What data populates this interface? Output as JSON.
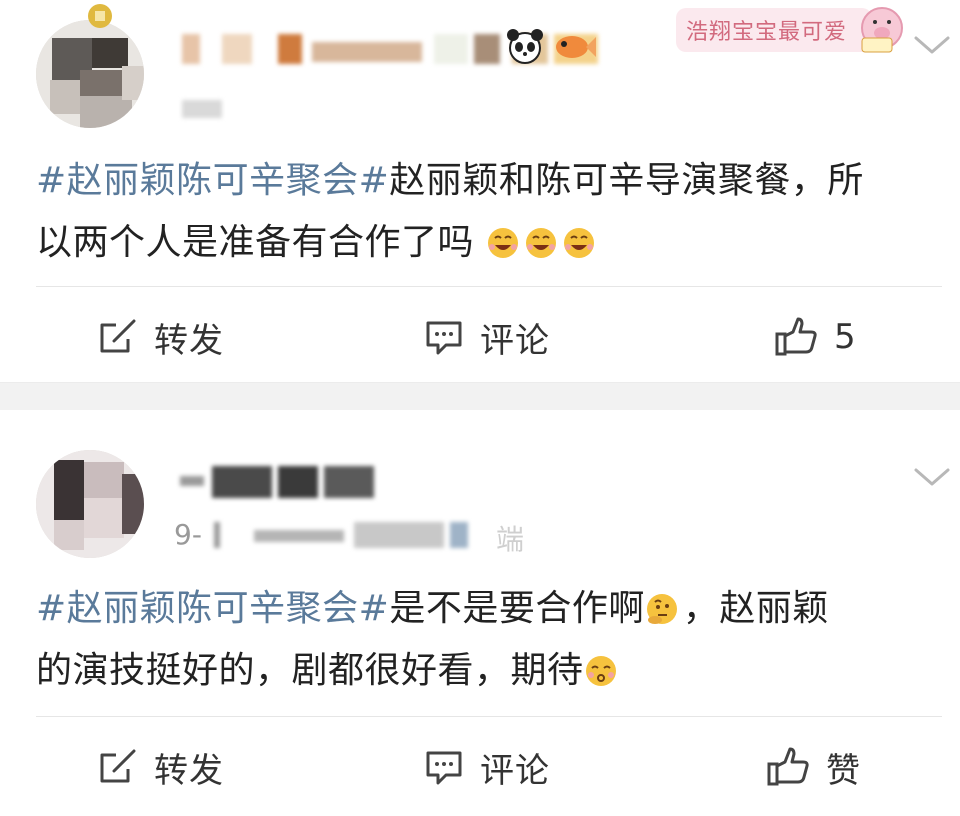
{
  "posts": [
    {
      "sticker_text": "浩翔宝宝最可爱",
      "topic": "#赵丽颖陈可辛聚会#",
      "text_line1": "赵丽颖和陈可辛导演聚餐，所",
      "text_line2": "以两个人是准备有合作了吗",
      "emojis": [
        "laughing-face-emoji",
        "laughing-face-emoji",
        "laughing-face-emoji"
      ],
      "actions": {
        "repost_label": "转发",
        "comment_label": "评论",
        "like_label": "5"
      }
    },
    {
      "meta_prefix": "9-",
      "meta_suffix": "端",
      "topic": "#赵丽颖陈可辛聚会#",
      "text_line1_a": "是不是要合作啊",
      "text_line1_b": "，赵丽颖",
      "text_line2": "的演技挺好的，剧都很好看，期待",
      "emojis": [
        "thinking-face-emoji",
        "kissing-face-emoji"
      ],
      "actions": {
        "repost_label": "转发",
        "comment_label": "评论",
        "like_label": "赞"
      }
    }
  ],
  "colors": {
    "topic": "#5a7a9a",
    "text": "#222222",
    "icon": "#444444",
    "separator_band": "#f2f2f2"
  }
}
